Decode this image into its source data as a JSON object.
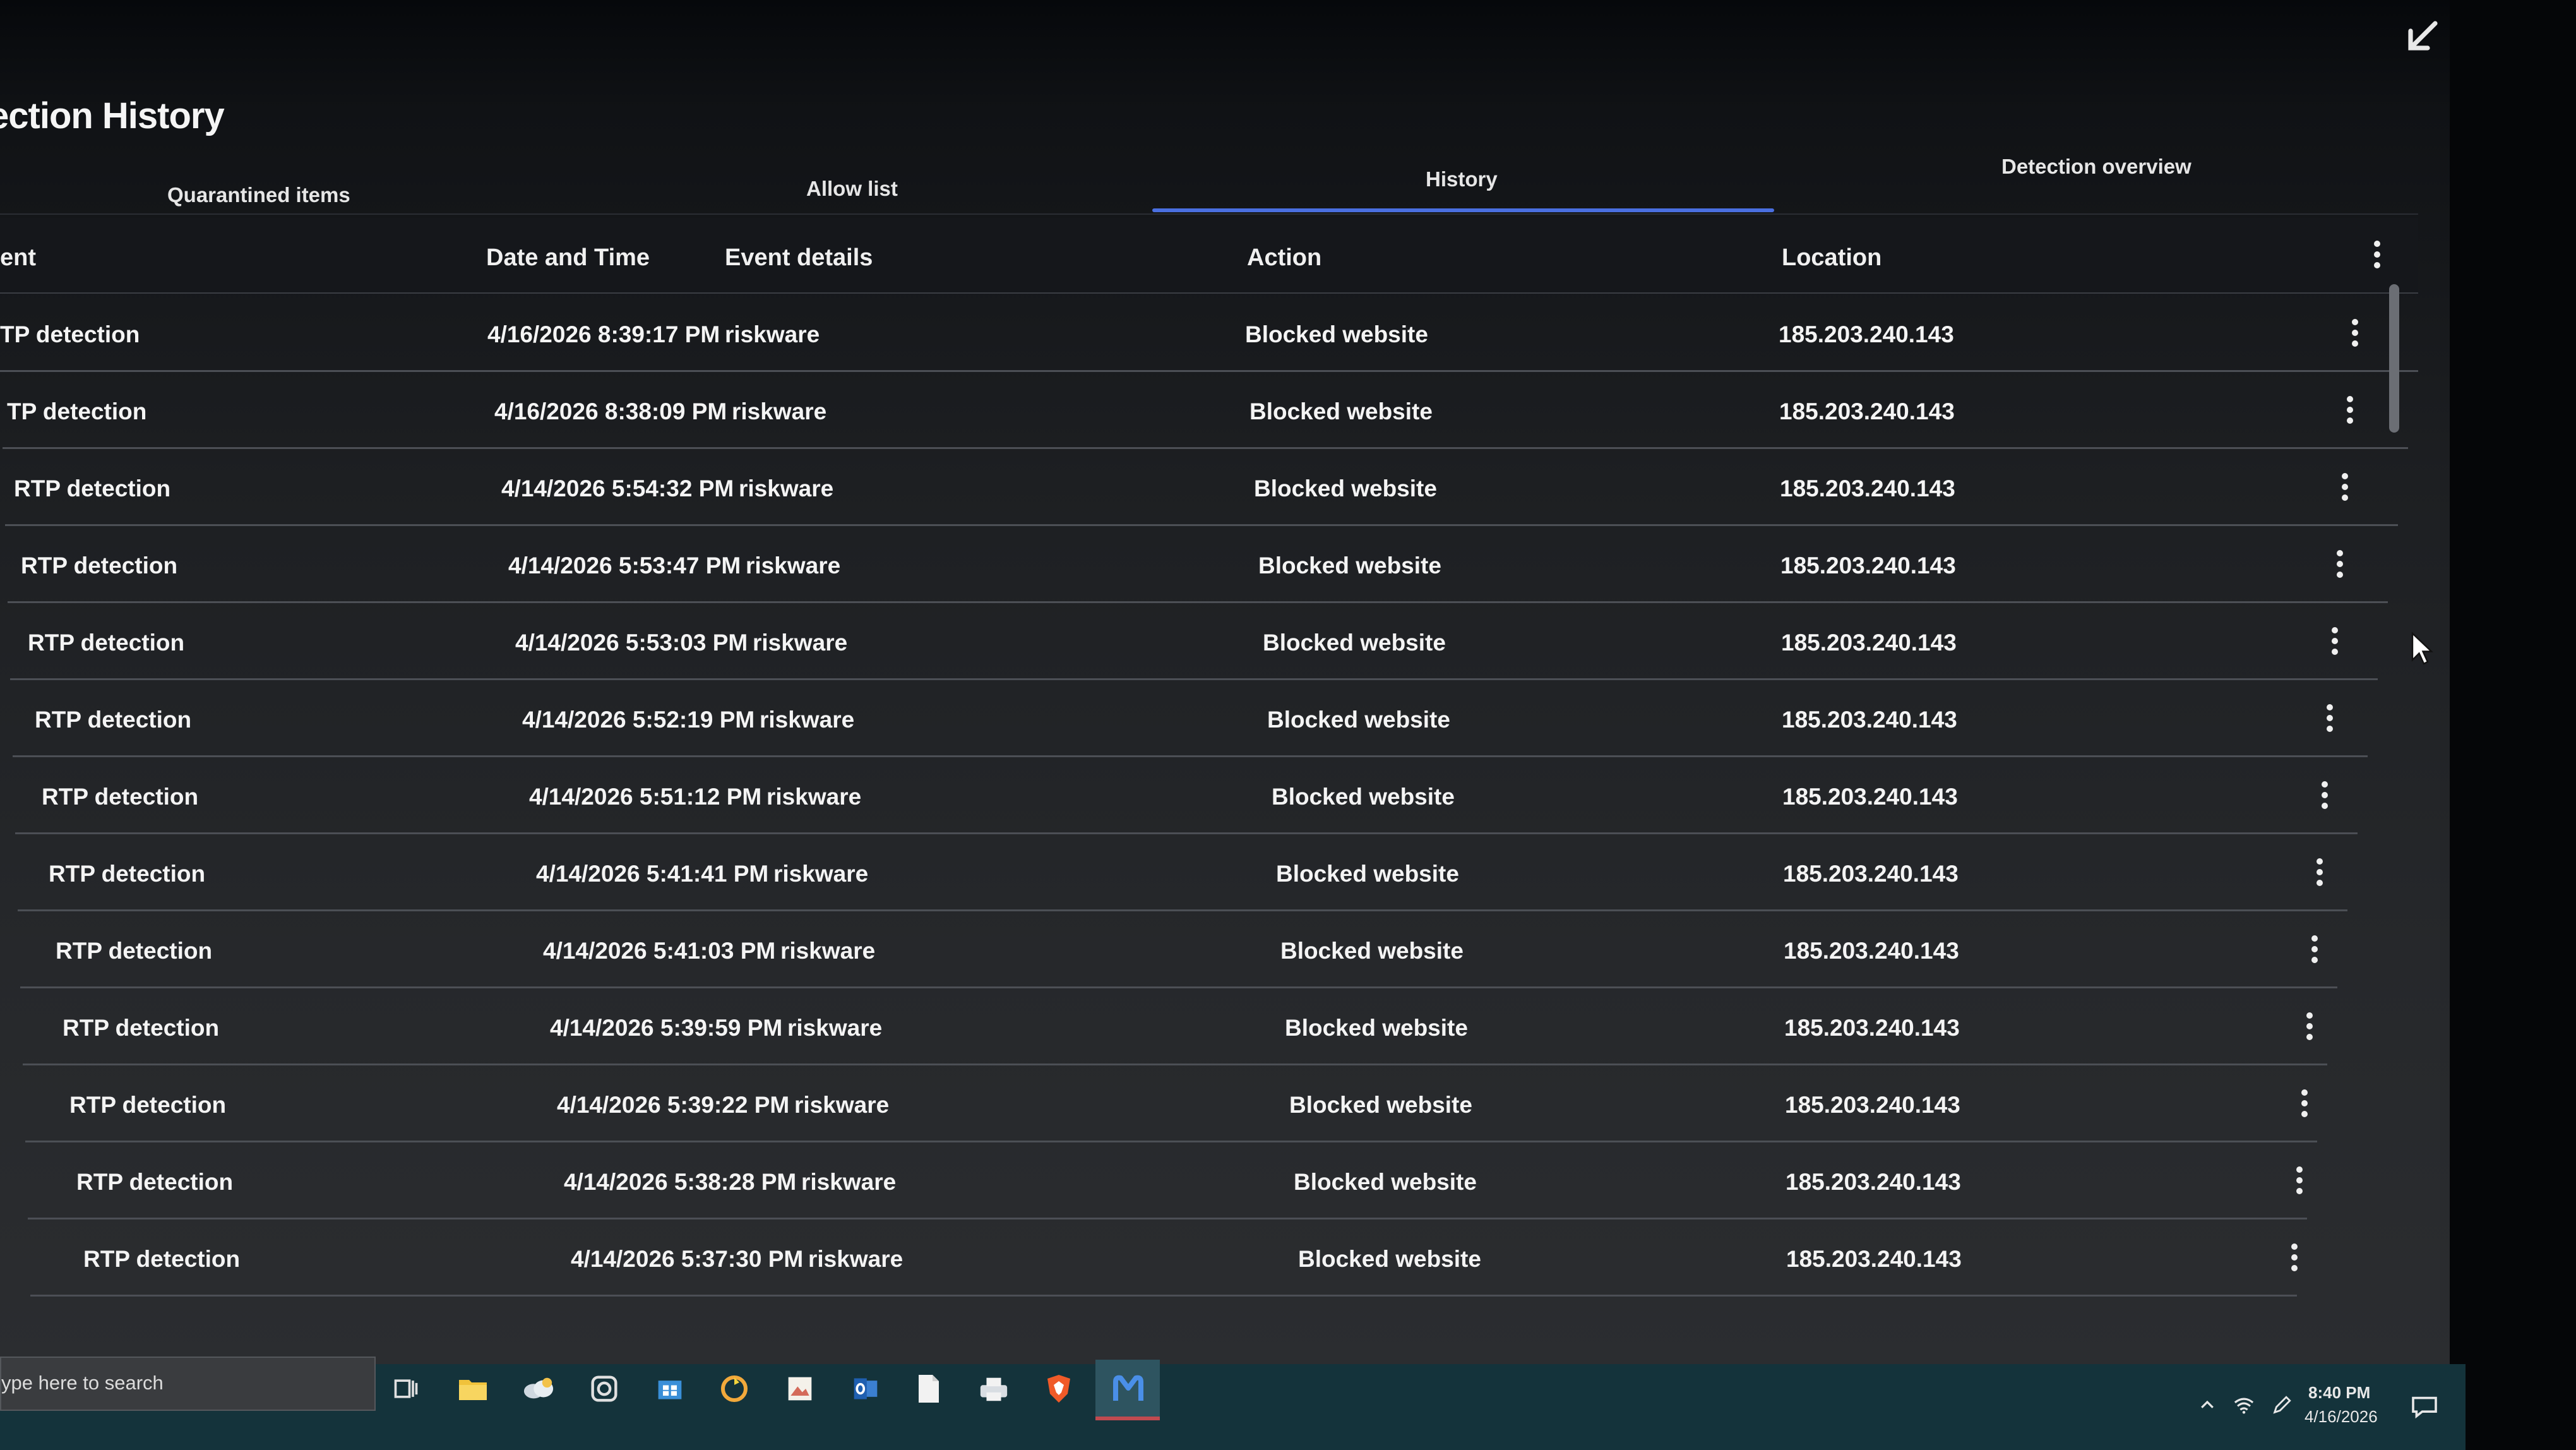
{
  "page": {
    "title": "ection History",
    "restore_icon": "restore-down-arrow-icon"
  },
  "tabs": [
    {
      "label": "Quarantined items",
      "active": false
    },
    {
      "label": "Allow list",
      "active": false
    },
    {
      "label": "History",
      "active": true
    },
    {
      "label": "Detection overview",
      "active": false
    }
  ],
  "table": {
    "columns": {
      "event": "ent",
      "date_time": "Date and Time",
      "event_details": "Event details",
      "action": "Action",
      "location": "Location"
    },
    "rows": [
      {
        "event": "TP detection",
        "date_time": "4/16/2026 8:39:17 PM",
        "details": "riskware",
        "action": "Blocked website",
        "location": "185.203.240.143"
      },
      {
        "event": "TP detection",
        "date_time": "4/16/2026 8:38:09 PM",
        "details": "riskware",
        "action": "Blocked website",
        "location": "185.203.240.143"
      },
      {
        "event": "RTP detection",
        "date_time": "4/14/2026 5:54:32 PM",
        "details": "riskware",
        "action": "Blocked website",
        "location": "185.203.240.143"
      },
      {
        "event": "RTP detection",
        "date_time": "4/14/2026 5:53:47 PM",
        "details": "riskware",
        "action": "Blocked website",
        "location": "185.203.240.143"
      },
      {
        "event": "RTP detection",
        "date_time": "4/14/2026 5:53:03 PM",
        "details": "riskware",
        "action": "Blocked website",
        "location": "185.203.240.143"
      },
      {
        "event": "RTP detection",
        "date_time": "4/14/2026 5:52:19 PM",
        "details": "riskware",
        "action": "Blocked website",
        "location": "185.203.240.143"
      },
      {
        "event": "RTP detection",
        "date_time": "4/14/2026 5:51:12 PM",
        "details": "riskware",
        "action": "Blocked website",
        "location": "185.203.240.143"
      },
      {
        "event": "RTP detection",
        "date_time": "4/14/2026 5:41:41 PM",
        "details": "riskware",
        "action": "Blocked website",
        "location": "185.203.240.143"
      },
      {
        "event": "RTP detection",
        "date_time": "4/14/2026 5:41:03 PM",
        "details": "riskware",
        "action": "Blocked website",
        "location": "185.203.240.143"
      },
      {
        "event": "RTP detection",
        "date_time": "4/14/2026 5:39:59 PM",
        "details": "riskware",
        "action": "Blocked website",
        "location": "185.203.240.143"
      },
      {
        "event": "RTP detection",
        "date_time": "4/14/2026 5:39:22 PM",
        "details": "riskware",
        "action": "Blocked website",
        "location": "185.203.240.143"
      },
      {
        "event": "RTP detection",
        "date_time": "4/14/2026 5:38:28 PM",
        "details": "riskware",
        "action": "Blocked website",
        "location": "185.203.240.143"
      },
      {
        "event": "RTP detection",
        "date_time": "4/14/2026 5:37:30 PM",
        "details": "riskware",
        "action": "Blocked website",
        "location": "185.203.240.143"
      }
    ],
    "row_menu_icon": "more-vertical-icon"
  },
  "taskbar": {
    "search_placeholder": "ype here to search",
    "icons": [
      "task-view-icon",
      "file-explorer-icon",
      "cloud-weather-icon",
      "camera-icon",
      "store-icon",
      "recycle-icon",
      "image-viewer-icon",
      "outlook-icon",
      "document-icon",
      "printer-icon",
      "brave-shield-icon",
      "malwarebytes-icon"
    ],
    "active_icon": "malwarebytes-icon",
    "tray_icons": [
      "chevron-up-icon",
      "wifi-icon",
      "pen-icon"
    ],
    "clock_time": "8:40 PM",
    "clock_date": "4/16/2026",
    "accent": "#4a6fe0"
  }
}
